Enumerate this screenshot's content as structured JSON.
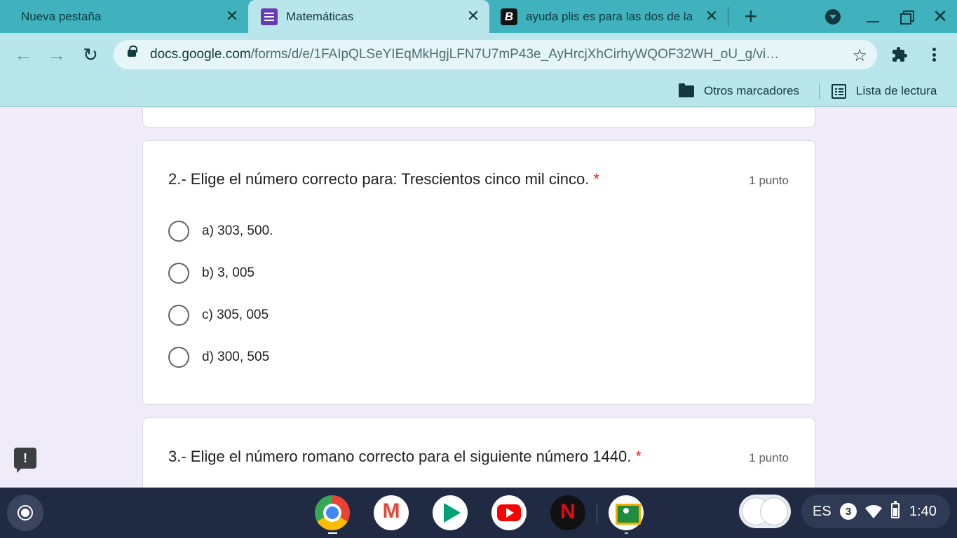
{
  "browser": {
    "tabs": [
      {
        "title": "Nueva pestaña",
        "favicon": "none",
        "active": false
      },
      {
        "title": "Matemáticas",
        "favicon": "google-forms-icon",
        "active": true
      },
      {
        "title": "ayuda plis es para las dos de la",
        "favicon": "brainly-icon",
        "active": false
      }
    ],
    "url_host": "docs.google.com",
    "url_path": "/forms/d/e/1FAIpQLSeYIEqMkHgjLFN7U7mP43e_AyHrcjXhCirhyWQOF32WH_oU_g/vi…",
    "bookmarks": {
      "folder": "Otros marcadores",
      "reading_list": "Lista de lectura"
    },
    "colors": {
      "frame": "#3fb2bd",
      "toolbar": "#b9e6ea"
    }
  },
  "form": {
    "background": "#f0ebf8",
    "questions": [
      {
        "title": "2.- Elige el número correcto para: Trescientos cinco mil cinco.",
        "required_mark": "*",
        "points": "1 punto",
        "options": [
          "a) 303, 500.",
          "b) 3, 005",
          "c) 305, 005",
          "d) 300, 505"
        ]
      },
      {
        "title": "3.- Elige el número romano correcto para el siguiente número 1440.",
        "required_mark": "*",
        "points": "1 punto"
      }
    ],
    "feedback_icon": "!"
  },
  "shelf": {
    "apps": [
      "chrome-icon",
      "gmail-icon",
      "play-store-icon",
      "youtube-icon",
      "netflix-icon",
      "classroom-icon"
    ],
    "input_method": "ES",
    "notification_count": "3",
    "time": "1:40"
  }
}
